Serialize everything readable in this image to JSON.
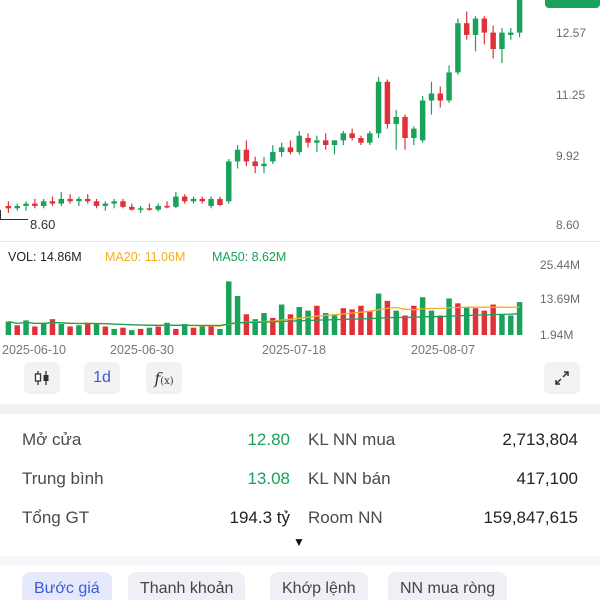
{
  "price_axis": [
    "12.57",
    "11.25",
    "9.92",
    "8.60"
  ],
  "low_marker": "8.60",
  "volume_legend": {
    "vol": "VOL: 14.86M",
    "ma20": "MA20: 11.06M",
    "ma50": "MA50: 8.62M"
  },
  "volume_axis": [
    "25.44M",
    "13.69M",
    "1.94M"
  ],
  "dates": [
    "2025-06-10",
    "2025-06-30",
    "2025-07-18",
    "2025-08-07"
  ],
  "toolbar": {
    "candle_icon": "candlestick-icon",
    "interval_label": "1d",
    "indicator_icon": "function-icon",
    "expand_icon": "expand-icon"
  },
  "stats": {
    "open_label": "Mở cửa",
    "open_value": "12.80",
    "avg_label": "Trung bình",
    "avg_value": "13.08",
    "total_label": "Tổng GT",
    "total_value": "194.3 tỷ",
    "fbuy_label": "KL NN mua",
    "fbuy_value": "2,713,804",
    "fsell_label": "KL NN bán",
    "fsell_value": "417,100",
    "room_label": "Room NN",
    "room_value": "159,847,615"
  },
  "tabs": [
    "Bước giá",
    "Thanh khoản",
    "Khớp lệnh",
    "NN mua ròng"
  ],
  "colors": {
    "up": "#1aa15a",
    "down": "#e0313b",
    "ma20": "#f2b01e",
    "ma50": "#1aa15a",
    "accent": "#3b5bdb"
  },
  "chart_data": {
    "type": "candlestick",
    "y_axis_ticks": [
      12.57,
      11.25,
      9.92,
      8.6
    ],
    "x_tick_labels": [
      "2025-06-10",
      "2025-06-30",
      "2025-07-18",
      "2025-08-07"
    ],
    "candles": [
      {
        "o": 8.9,
        "h": 9.0,
        "l": 8.75,
        "c": 8.85
      },
      {
        "o": 8.85,
        "h": 8.95,
        "l": 8.8,
        "c": 8.9
      },
      {
        "o": 8.9,
        "h": 9.0,
        "l": 8.8,
        "c": 8.95
      },
      {
        "o": 8.95,
        "h": 9.05,
        "l": 8.85,
        "c": 8.9
      },
      {
        "o": 8.9,
        "h": 9.05,
        "l": 8.85,
        "c": 9.0
      },
      {
        "o": 9.0,
        "h": 9.1,
        "l": 8.9,
        "c": 8.95
      },
      {
        "o": 8.95,
        "h": 9.2,
        "l": 8.9,
        "c": 9.05
      },
      {
        "o": 9.05,
        "h": 9.15,
        "l": 8.95,
        "c": 9.0
      },
      {
        "o": 9.0,
        "h": 9.1,
        "l": 8.9,
        "c": 9.05
      },
      {
        "o": 9.05,
        "h": 9.15,
        "l": 8.95,
        "c": 9.0
      },
      {
        "o": 9.0,
        "h": 9.05,
        "l": 8.85,
        "c": 8.9
      },
      {
        "o": 8.9,
        "h": 9.0,
        "l": 8.8,
        "c": 8.95
      },
      {
        "o": 8.95,
        "h": 9.05,
        "l": 8.85,
        "c": 9.0
      },
      {
        "o": 9.0,
        "h": 9.05,
        "l": 8.85,
        "c": 8.88
      },
      {
        "o": 8.88,
        "h": 8.95,
        "l": 8.8,
        "c": 8.82
      },
      {
        "o": 8.82,
        "h": 8.9,
        "l": 8.75,
        "c": 8.85
      },
      {
        "o": 8.85,
        "h": 8.95,
        "l": 8.8,
        "c": 8.82
      },
      {
        "o": 8.82,
        "h": 8.95,
        "l": 8.78,
        "c": 8.9
      },
      {
        "o": 8.9,
        "h": 9.0,
        "l": 8.85,
        "c": 8.88
      },
      {
        "o": 8.88,
        "h": 9.2,
        "l": 8.85,
        "c": 9.1
      },
      {
        "o": 9.1,
        "h": 9.15,
        "l": 8.95,
        "c": 9.0
      },
      {
        "o": 9.0,
        "h": 9.1,
        "l": 8.95,
        "c": 9.05
      },
      {
        "o": 9.05,
        "h": 9.1,
        "l": 8.95,
        "c": 9.0
      },
      {
        "o": 8.9,
        "h": 9.1,
        "l": 8.85,
        "c": 9.05
      },
      {
        "o": 9.05,
        "h": 9.1,
        "l": 8.9,
        "c": 8.92
      },
      {
        "o": 9.0,
        "h": 9.9,
        "l": 8.95,
        "c": 9.85
      },
      {
        "o": 9.85,
        "h": 10.2,
        "l": 9.7,
        "c": 10.1
      },
      {
        "o": 10.1,
        "h": 10.3,
        "l": 9.75,
        "c": 9.85
      },
      {
        "o": 9.85,
        "h": 9.95,
        "l": 9.6,
        "c": 9.75
      },
      {
        "o": 9.75,
        "h": 9.95,
        "l": 9.6,
        "c": 9.8
      },
      {
        "o": 9.85,
        "h": 10.2,
        "l": 9.8,
        "c": 10.05
      },
      {
        "o": 10.05,
        "h": 10.25,
        "l": 9.95,
        "c": 10.15
      },
      {
        "o": 10.15,
        "h": 10.3,
        "l": 10.0,
        "c": 10.05
      },
      {
        "o": 10.05,
        "h": 10.5,
        "l": 10.0,
        "c": 10.4
      },
      {
        "o": 10.35,
        "h": 10.45,
        "l": 10.15,
        "c": 10.25
      },
      {
        "o": 10.25,
        "h": 10.4,
        "l": 10.05,
        "c": 10.3
      },
      {
        "o": 10.3,
        "h": 10.45,
        "l": 10.1,
        "c": 10.2
      },
      {
        "o": 10.2,
        "h": 10.3,
        "l": 10.0,
        "c": 10.3
      },
      {
        "o": 10.3,
        "h": 10.5,
        "l": 10.2,
        "c": 10.45
      },
      {
        "o": 10.45,
        "h": 10.55,
        "l": 10.3,
        "c": 10.35
      },
      {
        "o": 10.35,
        "h": 10.4,
        "l": 10.2,
        "c": 10.25
      },
      {
        "o": 10.25,
        "h": 10.5,
        "l": 10.2,
        "c": 10.45
      },
      {
        "o": 10.45,
        "h": 11.65,
        "l": 10.35,
        "c": 11.55
      },
      {
        "o": 11.55,
        "h": 11.6,
        "l": 10.55,
        "c": 10.65
      },
      {
        "o": 10.65,
        "h": 10.95,
        "l": 10.1,
        "c": 10.8
      },
      {
        "o": 10.8,
        "h": 10.85,
        "l": 10.1,
        "c": 10.35
      },
      {
        "o": 10.35,
        "h": 10.6,
        "l": 10.2,
        "c": 10.55
      },
      {
        "o": 10.3,
        "h": 11.25,
        "l": 10.25,
        "c": 11.15
      },
      {
        "o": 11.15,
        "h": 11.55,
        "l": 10.85,
        "c": 11.3
      },
      {
        "o": 11.3,
        "h": 11.45,
        "l": 11.0,
        "c": 11.15
      },
      {
        "o": 11.15,
        "h": 11.9,
        "l": 11.1,
        "c": 11.75
      },
      {
        "o": 11.75,
        "h": 12.9,
        "l": 11.7,
        "c": 12.8
      },
      {
        "o": 12.8,
        "h": 13.05,
        "l": 12.45,
        "c": 12.55
      },
      {
        "o": 12.55,
        "h": 12.95,
        "l": 12.2,
        "c": 12.9
      },
      {
        "o": 12.9,
        "h": 12.95,
        "l": 12.35,
        "c": 12.6
      },
      {
        "o": 12.6,
        "h": 12.75,
        "l": 12.05,
        "c": 12.25
      },
      {
        "o": 12.25,
        "h": 12.7,
        "l": 11.95,
        "c": 12.6
      },
      {
        "o": 12.55,
        "h": 12.7,
        "l": 12.45,
        "c": 12.6
      },
      {
        "o": 12.6,
        "h": 13.6,
        "l": 12.5,
        "c": 13.5
      }
    ],
    "volume": [
      {
        "v": 5.5,
        "up": true
      },
      {
        "v": 4.0,
        "up": false
      },
      {
        "v": 6.0,
        "up": true
      },
      {
        "v": 3.5,
        "up": false
      },
      {
        "v": 5.0,
        "up": true
      },
      {
        "v": 6.5,
        "up": false
      },
      {
        "v": 4.5,
        "up": true
      },
      {
        "v": 3.5,
        "up": false
      },
      {
        "v": 4.0,
        "up": true
      },
      {
        "v": 5.0,
        "up": false
      },
      {
        "v": 4.5,
        "up": true
      },
      {
        "v": 3.5,
        "up": false
      },
      {
        "v": 2.5,
        "up": true
      },
      {
        "v": 3.0,
        "up": false
      },
      {
        "v": 2.0,
        "up": true
      },
      {
        "v": 2.5,
        "up": false
      },
      {
        "v": 3.0,
        "up": true
      },
      {
        "v": 3.5,
        "up": false
      },
      {
        "v": 5.0,
        "up": true
      },
      {
        "v": 2.5,
        "up": false
      },
      {
        "v": 4.5,
        "up": true
      },
      {
        "v": 3.0,
        "up": false
      },
      {
        "v": 3.5,
        "up": true
      },
      {
        "v": 4.0,
        "up": false
      },
      {
        "v": 2.5,
        "up": true
      },
      {
        "v": 22.0,
        "up": true
      },
      {
        "v": 16.0,
        "up": true
      },
      {
        "v": 8.5,
        "up": false
      },
      {
        "v": 6.5,
        "up": true
      },
      {
        "v": 9.0,
        "up": true
      },
      {
        "v": 7.0,
        "up": false
      },
      {
        "v": 12.5,
        "up": true
      },
      {
        "v": 8.5,
        "up": false
      },
      {
        "v": 11.5,
        "up": true
      },
      {
        "v": 10.0,
        "up": true
      },
      {
        "v": 12.0,
        "up": false
      },
      {
        "v": 9.0,
        "up": true
      },
      {
        "v": 8.5,
        "up": true
      },
      {
        "v": 11.0,
        "up": false
      },
      {
        "v": 10.5,
        "up": false
      },
      {
        "v": 12.0,
        "up": false
      },
      {
        "v": 10.0,
        "up": false
      },
      {
        "v": 17.0,
        "up": true
      },
      {
        "v": 14.0,
        "up": false
      },
      {
        "v": 10.0,
        "up": true
      },
      {
        "v": 8.0,
        "up": false
      },
      {
        "v": 12.0,
        "up": false
      },
      {
        "v": 15.5,
        "up": true
      },
      {
        "v": 10.0,
        "up": true
      },
      {
        "v": 8.0,
        "up": false
      },
      {
        "v": 15.0,
        "up": true
      },
      {
        "v": 13.0,
        "up": false
      },
      {
        "v": 11.5,
        "up": true
      },
      {
        "v": 11.0,
        "up": false
      },
      {
        "v": 10.0,
        "up": false
      },
      {
        "v": 12.5,
        "up": false
      },
      {
        "v": 8.5,
        "up": true
      },
      {
        "v": 8.0,
        "up": true
      },
      {
        "v": 13.5,
        "up": true
      }
    ]
  }
}
